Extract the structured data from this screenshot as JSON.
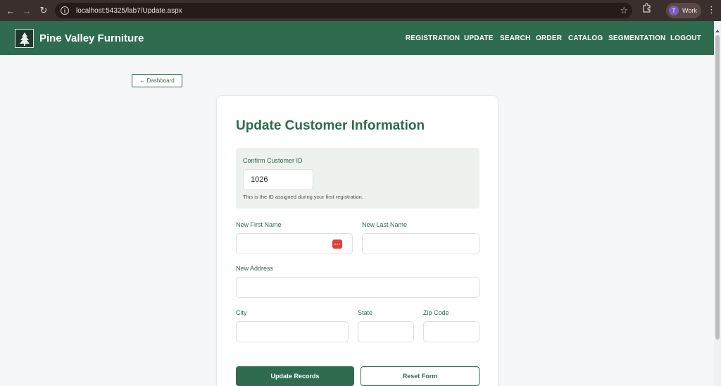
{
  "browser": {
    "url": "localhost:54325/lab7/Update.aspx",
    "profile_initial": "T",
    "profile_name": "Work"
  },
  "site": {
    "brand": "Pine Valley Furniture",
    "nav": [
      "REGISTRATION",
      "UPDATE",
      "SEARCH",
      "ORDER",
      "CATALOG",
      "SEGMENTATION",
      "LOGOUT"
    ]
  },
  "dashboard_button": "← Dashboard",
  "form": {
    "title": "Update Customer Information",
    "confirm": {
      "label": "Confirm Customer ID",
      "value": "1026",
      "hint": "This is the ID assigned during your first registration."
    },
    "first_name_label": "New First Name",
    "last_name_label": "New Last Name",
    "address_label": "New Address",
    "city_label": "City",
    "state_label": "State",
    "zip_label": "Zip Code",
    "update_button": "Update Records",
    "reset_button": "Reset Form"
  },
  "icons": {
    "back": "back-arrow-icon",
    "forward": "forward-arrow-icon",
    "reload": "reload-icon",
    "info": "info-icon",
    "bookmark": "star-icon",
    "extensions": "puzzle-icon",
    "menu": "kebab-icon",
    "logo": "pine-tree-icon",
    "autofill": "password-dots-icon"
  },
  "colors": {
    "brand_green": "#2e6b4f",
    "chrome_dark": "#3b2f2d",
    "autofill_red": "#e0413a"
  }
}
